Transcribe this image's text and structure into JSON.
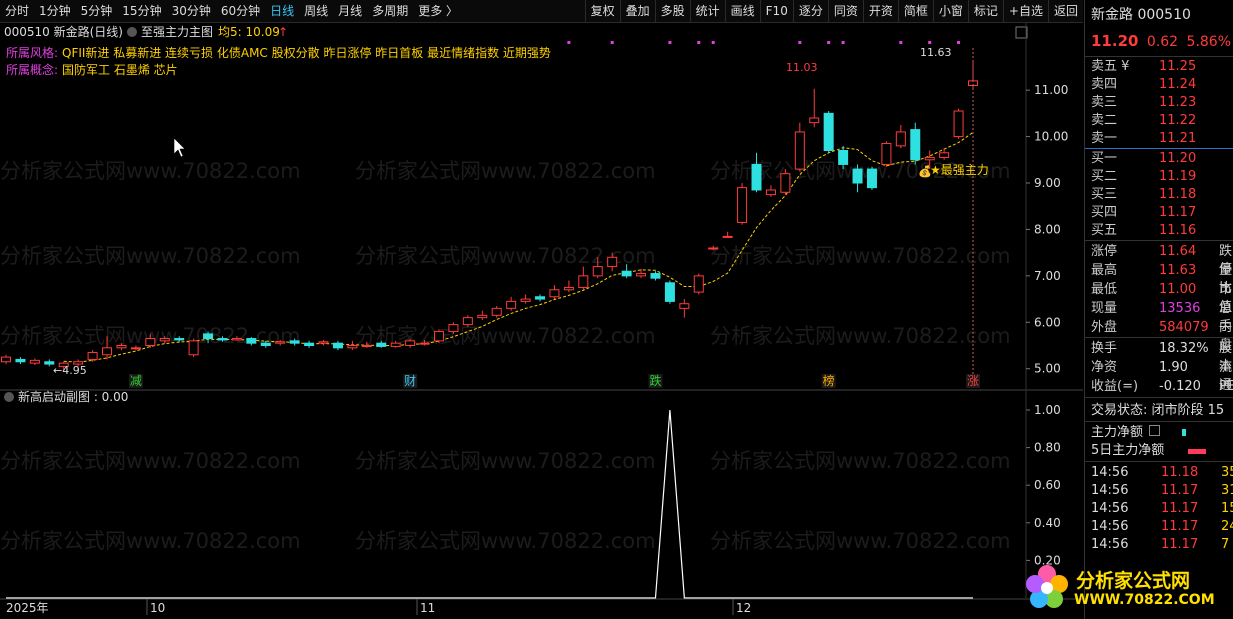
{
  "toolbar": {
    "left": [
      "分时",
      "1分钟",
      "5分钟",
      "15分钟",
      "30分钟",
      "60分钟",
      "日线",
      "周线",
      "月线",
      "多周期",
      "更多 〉"
    ],
    "active_index": 6,
    "right": [
      "复权",
      "叠加",
      "多股",
      "统计",
      "画线",
      "F10",
      "逐分",
      "同资",
      "开资",
      "简框",
      "小窗",
      "标记",
      "+自选",
      "返回"
    ]
  },
  "main": {
    "style_label": "所属风格:",
    "style_values": "QFII新进 私募新进 连续亏损 化债AMC 股权分散 昨日涨停 昨日首板 最近情绪指数 近期强势",
    "concept_label": "所属概念:",
    "concept_values": "国防军工 石墨烯 芯片",
    "header_code": "000510 新金路(日线)",
    "indicator_name": "至强主力主图",
    "ma_label": "均5: 10.09",
    "arrow_up": "↑",
    "annotation_high": "11.03",
    "annotation_top": "11.63",
    "annotation_low": "←4.95",
    "main_force_label": "★最强主力",
    "events": [
      "减",
      "财",
      "跌",
      "榜",
      "涨"
    ],
    "price_axis": [
      "11.00",
      "10.00",
      "9.00",
      "8.00",
      "7.00",
      "6.00",
      "5.00"
    ],
    "watermarks": [
      "分析家公式网www.70822.com",
      "分析家公式网www.70822.com",
      "分析家公式网www.70822.com"
    ]
  },
  "sub": {
    "title": "新高启动副图 : 0.00",
    "axis": [
      "1.00",
      "0.80",
      "0.60",
      "0.40",
      "0.20"
    ]
  },
  "time_axis": [
    "2025年",
    "10",
    "11",
    "12"
  ],
  "right_panel": {
    "stock_name": "新金路",
    "stock_code": "000510",
    "price": "11.20",
    "change": "0.62",
    "change_pct": "5.86%",
    "sell": [
      {
        "label": "卖五 ¥",
        "price": "11.25"
      },
      {
        "label": "卖四",
        "price": "11.24"
      },
      {
        "label": "卖三",
        "price": "11.23"
      },
      {
        "label": "卖二",
        "price": "11.22"
      },
      {
        "label": "卖一",
        "price": "11.21"
      }
    ],
    "buy": [
      {
        "label": "买一",
        "price": "11.20"
      },
      {
        "label": "买二",
        "price": "11.19"
      },
      {
        "label": "买三",
        "price": "11.18"
      },
      {
        "label": "买四",
        "price": "11.17"
      },
      {
        "label": "买五",
        "price": "11.16"
      }
    ],
    "stats": [
      {
        "label": "涨停",
        "value": "11.64",
        "extra": "跌停"
      },
      {
        "label": "最高",
        "value": "11.63",
        "extra": "量比"
      },
      {
        "label": "最低",
        "value": "11.00",
        "extra": "市值"
      },
      {
        "label": "现量",
        "value": "13536",
        "extra": "总手"
      },
      {
        "label": "外盘",
        "value": "584079",
        "extra": "内盘"
      }
    ],
    "stats2": [
      {
        "label": "换手",
        "value": "18.32%",
        "extra": "股本"
      },
      {
        "label": "净资",
        "value": "1.90",
        "extra": "流通"
      },
      {
        "label": "收益(=)",
        "value": "-0.120",
        "extra": "PE"
      }
    ],
    "trade_status": "交易状态: 闭市阶段 15",
    "main_net": "主力净额",
    "main_net_5d": "5日主力净额",
    "ticks": [
      {
        "time": "14:56",
        "price": "11.18",
        "vol": "35"
      },
      {
        "time": "14:56",
        "price": "11.17",
        "vol": "31"
      },
      {
        "time": "14:56",
        "price": "11.17",
        "vol": "15"
      },
      {
        "time": "14:56",
        "price": "11.17",
        "vol": "24"
      },
      {
        "time": "14:56",
        "price": "11.17",
        "vol": "7"
      }
    ]
  },
  "logo": {
    "name": "分析家公式网",
    "url": "WWW.70822.COM"
  },
  "colors": {
    "up": "#ff3b3b",
    "down": "#2fe0e0",
    "ma": "#ffd000",
    "bg": "#000000"
  },
  "chart_data": {
    "type": "candlestick",
    "ylim": [
      4.8,
      11.8
    ],
    "candles": [
      [
        5.15,
        5.25,
        5.3,
        5.1
      ],
      [
        5.2,
        5.15,
        5.25,
        5.1
      ],
      [
        5.12,
        5.18,
        5.22,
        5.08
      ],
      [
        5.15,
        5.1,
        5.2,
        5.05
      ],
      [
        5.05,
        5.12,
        5.15,
        4.95
      ],
      [
        5.1,
        5.15,
        5.2,
        5.05
      ],
      [
        5.2,
        5.35,
        5.4,
        5.15
      ],
      [
        5.3,
        5.45,
        5.7,
        5.2
      ],
      [
        5.45,
        5.5,
        5.55,
        5.4
      ],
      [
        5.45,
        5.45,
        5.5,
        5.4
      ],
      [
        5.5,
        5.65,
        5.75,
        5.45
      ],
      [
        5.6,
        5.65,
        5.7,
        5.55
      ],
      [
        5.65,
        5.62,
        5.7,
        5.58
      ],
      [
        5.3,
        5.6,
        5.65,
        5.25
      ],
      [
        5.75,
        5.65,
        5.8,
        5.55
      ],
      [
        5.65,
        5.62,
        5.7,
        5.58
      ],
      [
        5.62,
        5.65,
        5.7,
        5.6
      ],
      [
        5.65,
        5.55,
        5.68,
        5.5
      ],
      [
        5.55,
        5.5,
        5.6,
        5.45
      ],
      [
        5.55,
        5.58,
        5.62,
        5.5
      ],
      [
        5.6,
        5.55,
        5.65,
        5.5
      ],
      [
        5.55,
        5.5,
        5.6,
        5.45
      ],
      [
        5.55,
        5.58,
        5.62,
        5.5
      ],
      [
        5.55,
        5.45,
        5.6,
        5.4
      ],
      [
        5.45,
        5.5,
        5.6,
        5.4
      ],
      [
        5.5,
        5.5,
        5.58,
        5.45
      ],
      [
        5.55,
        5.48,
        5.6,
        5.45
      ],
      [
        5.48,
        5.55,
        5.6,
        5.45
      ],
      [
        5.5,
        5.6,
        5.65,
        5.45
      ],
      [
        5.55,
        5.55,
        5.62,
        5.5
      ],
      [
        5.6,
        5.8,
        5.85,
        5.55
      ],
      [
        5.8,
        5.95,
        6.0,
        5.75
      ],
      [
        5.95,
        6.1,
        6.15,
        5.9
      ],
      [
        6.1,
        6.15,
        6.25,
        6.05
      ],
      [
        6.15,
        6.3,
        6.35,
        6.1
      ],
      [
        6.3,
        6.45,
        6.55,
        6.25
      ],
      [
        6.45,
        6.5,
        6.6,
        6.4
      ],
      [
        6.55,
        6.5,
        6.6,
        6.45
      ],
      [
        6.55,
        6.7,
        6.8,
        6.5
      ],
      [
        6.7,
        6.75,
        6.9,
        6.65
      ],
      [
        6.75,
        7.0,
        7.2,
        6.7
      ],
      [
        7.0,
        7.2,
        7.4,
        6.95
      ],
      [
        7.2,
        7.4,
        7.5,
        7.1
      ],
      [
        7.1,
        7.0,
        7.25,
        6.95
      ],
      [
        7.0,
        7.05,
        7.15,
        6.95
      ],
      [
        7.05,
        6.95,
        7.1,
        6.9
      ],
      [
        6.85,
        6.45,
        6.9,
        6.4
      ],
      [
        6.3,
        6.4,
        6.5,
        6.1
      ],
      [
        6.65,
        7.0,
        7.05,
        6.6
      ],
      [
        7.6,
        7.6,
        7.65,
        7.55
      ],
      [
        7.85,
        7.85,
        7.95,
        7.85
      ],
      [
        8.15,
        8.9,
        9.0,
        8.1
      ],
      [
        9.4,
        8.85,
        9.65,
        8.8
      ],
      [
        8.75,
        8.85,
        8.95,
        8.7
      ],
      [
        8.8,
        9.2,
        9.3,
        8.75
      ],
      [
        9.3,
        10.1,
        10.3,
        9.25
      ],
      [
        10.3,
        10.4,
        11.03,
        10.2
      ],
      [
        10.5,
        9.7,
        10.55,
        9.65
      ],
      [
        9.7,
        9.4,
        9.8,
        9.3
      ],
      [
        9.3,
        9.0,
        9.4,
        8.8
      ],
      [
        9.3,
        8.9,
        9.35,
        8.85
      ],
      [
        9.4,
        9.85,
        9.9,
        9.35
      ],
      [
        9.8,
        10.1,
        10.25,
        9.75
      ],
      [
        10.15,
        9.5,
        10.3,
        9.4
      ],
      [
        9.5,
        9.55,
        9.7,
        9.3
      ],
      [
        9.55,
        9.65,
        9.75,
        9.5
      ],
      [
        10.0,
        10.55,
        10.6,
        9.95
      ],
      [
        11.1,
        11.2,
        11.63,
        11.0
      ]
    ],
    "sub_signal": {
      "index": 46,
      "value": 1.0
    }
  }
}
